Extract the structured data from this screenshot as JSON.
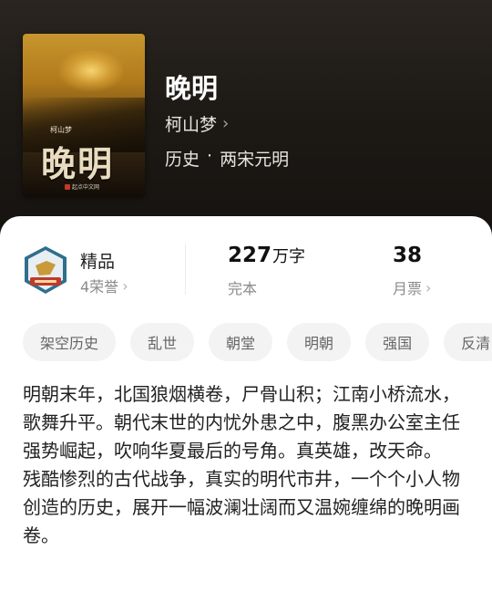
{
  "book": {
    "title": "晚明",
    "author": "柯山梦",
    "genre": [
      "历史",
      "·",
      "两宋元明"
    ]
  },
  "cover": {
    "title": "晚明",
    "author": "柯山梦",
    "publisher": "起点中文网"
  },
  "stats": {
    "quality": {
      "label": "精品",
      "honors": "4荣誉"
    },
    "words": {
      "value": "227",
      "unit": "万字",
      "status": "完本"
    },
    "tickets": {
      "value": "38",
      "label": "月票"
    }
  },
  "tags": [
    "架空历史",
    "乱世",
    "朝堂",
    "明朝",
    "强国",
    "反清"
  ],
  "description": [
    "明朝末年，北国狼烟横卷，尸骨山积；江南小桥流水，歌舞升平。朝代末世的内忧外患之中，腹黑办公室主任强势崛起，吹响华夏最后的号角。真英雄，改天命。",
    "残酷惨烈的古代战争，真实的明代市井，一个个小人物创造的历史，展开一幅波澜壮阔而又温婉缠绵的晚明画卷。"
  ]
}
